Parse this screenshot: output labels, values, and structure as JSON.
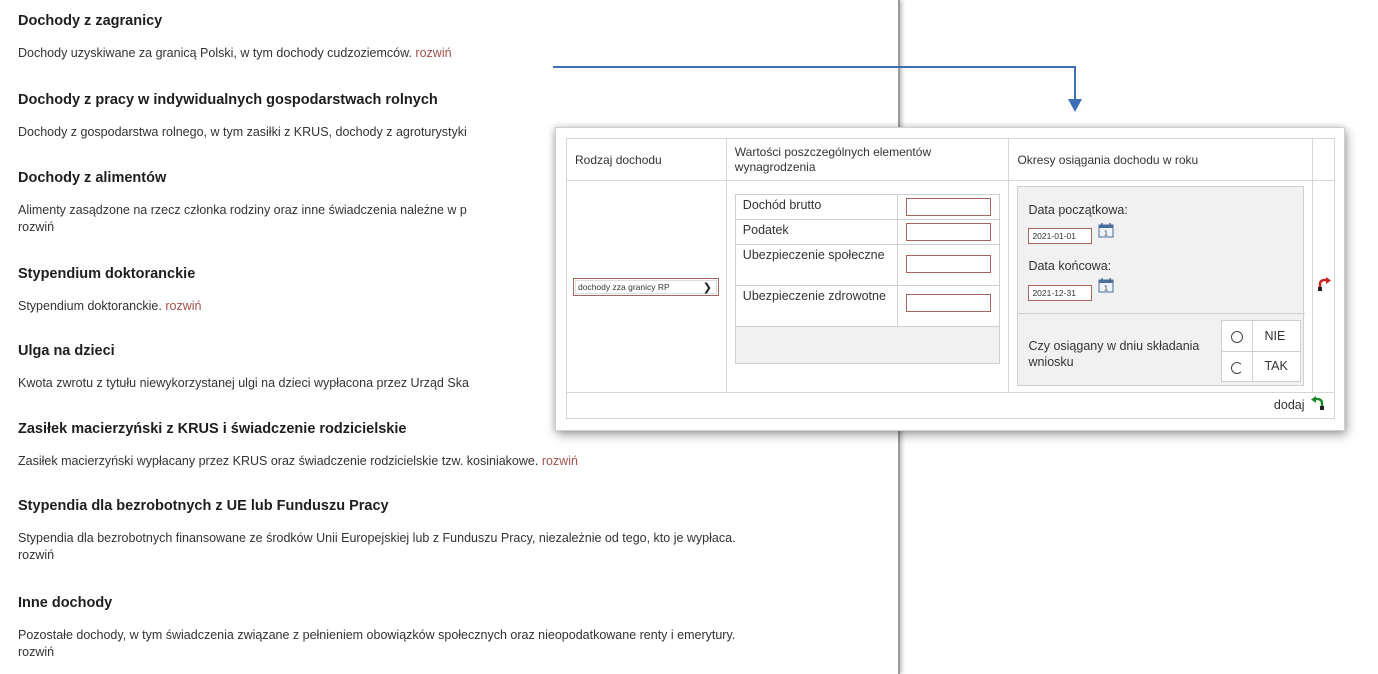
{
  "sections": [
    {
      "title": "Dochody z zagranicy",
      "text": "Dochody uzyskiwane za granicą Polski, w tym dochody cudzoziemców.",
      "more": "rozwiń"
    },
    {
      "title": "Dochody z pracy w indywidualnych gospodarstwach rolnych",
      "text": "Dochody z gospodarstwa rolnego, w tym zasiłki z KRUS, dochody z agroturystyki",
      "more": ""
    },
    {
      "title": "Dochody z alimentów",
      "text": "Alimenty zasądzone na rzecz członka rodziny oraz inne świadczenia należne w p",
      "more": "rozwiń"
    },
    {
      "title": "Stypendium doktoranckie",
      "text": "Stypendium doktoranckie.",
      "more": "rozwiń"
    },
    {
      "title": "Ulga na dzieci",
      "text": "Kwota zwrotu z tytułu niewykorzystanej ulgi na dzieci wypłacona przez Urząd Ska",
      "more": ""
    },
    {
      "title": "Zasiłek macierzyński z KRUS i świadczenie rodzicielskie",
      "text": "Zasiłek macierzyński wypłacany przez KRUS oraz świadczenie rodzicielskie tzw. kosiniakowe.",
      "more": "rozwiń"
    },
    {
      "title": "Stypendia dla bezrobotnych z UE lub Funduszu Pracy",
      "text": "Stypendia dla bezrobotnych finansowane ze środków Unii Europejskiej lub z Funduszu Pracy, niezależnie od tego, kto je wypłaca.",
      "more": "rozwiń"
    },
    {
      "title": "Inne dochody",
      "text": "Pozostałe dochody, w tym świadczenia związane z pełnieniem obowiązków społecznych oraz nieopodatkowane renty i emerytury.",
      "more": "rozwiń"
    }
  ],
  "popup": {
    "headers": {
      "type": "Rodzaj dochodu",
      "values": "Wartości poszczególnych elementów wynagrodzenia",
      "periods": "Okresy osiągania dochodu w roku"
    },
    "income_type_select": "dochody zza granicy RP",
    "value_rows": [
      {
        "label": "Dochód brutto",
        "value": ""
      },
      {
        "label": "Podatek",
        "value": ""
      },
      {
        "label": "Ubezpieczenie społeczne",
        "value": ""
      },
      {
        "label": "Ubezpieczenie zdrowotne",
        "value": ""
      }
    ],
    "start_label": "Data początkowa:",
    "start_value": "2021-01-01",
    "end_label": "Data końcowa:",
    "end_value": "2021-12-31",
    "question": "Czy osiągany w dniu składania wniosku",
    "answer_no": "NIE",
    "answer_yes": "TAK",
    "add_label": "dodaj",
    "colors": {
      "accent_border": "#a8635c",
      "link": "#a0524a",
      "connector": "#3d6fb6",
      "undo_red": "#cc2222",
      "redo_green": "#1d8a2a"
    }
  }
}
